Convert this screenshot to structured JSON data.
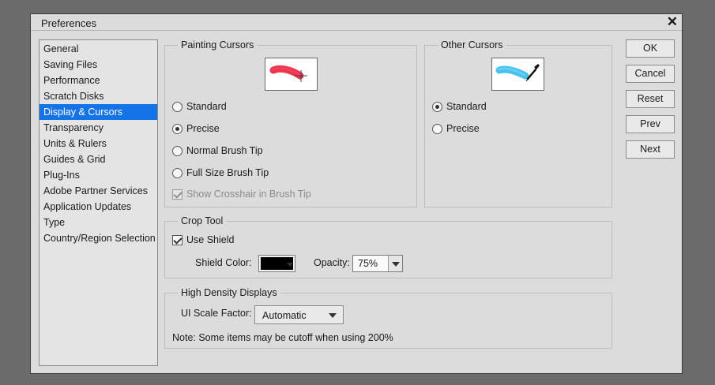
{
  "window": {
    "title": "Preferences"
  },
  "nav": {
    "items": [
      {
        "label": "General"
      },
      {
        "label": "Saving Files"
      },
      {
        "label": "Performance"
      },
      {
        "label": "Scratch Disks"
      },
      {
        "label": "Display & Cursors",
        "selected": true
      },
      {
        "label": "Transparency"
      },
      {
        "label": "Units & Rulers"
      },
      {
        "label": "Guides & Grid"
      },
      {
        "label": "Plug-Ins"
      },
      {
        "label": "Adobe Partner Services"
      },
      {
        "label": "Application Updates"
      },
      {
        "label": "Type"
      },
      {
        "label": "Country/Region Selection"
      }
    ]
  },
  "painting_cursors": {
    "title": "Painting Cursors",
    "selected": "Precise",
    "options": [
      "Standard",
      "Precise",
      "Normal Brush Tip",
      "Full Size Brush Tip"
    ],
    "crosshair": {
      "label": "Show Crosshair in Brush Tip",
      "checked": true,
      "disabled": true
    }
  },
  "other_cursors": {
    "title": "Other Cursors",
    "selected": "Standard",
    "options": [
      "Standard",
      "Precise"
    ]
  },
  "crop_tool": {
    "title": "Crop Tool",
    "use_shield": {
      "label": "Use Shield",
      "checked": true
    },
    "shield_color_label": "Shield Color:",
    "shield_color": "#000000",
    "opacity_label": "Opacity:",
    "opacity_value": "75%"
  },
  "high_density": {
    "title": "High Density Displays",
    "scale_label": "UI Scale Factor:",
    "scale_value": "Automatic",
    "note": "Note: Some items may be cutoff when using 200%"
  },
  "buttons": {
    "ok": "OK",
    "cancel": "Cancel",
    "reset": "Reset",
    "prev": "Prev",
    "next": "Next"
  },
  "colors": {
    "selection": "#1473e6",
    "painting_stroke": "#e8102f",
    "other_stroke": "#27b9e8"
  }
}
